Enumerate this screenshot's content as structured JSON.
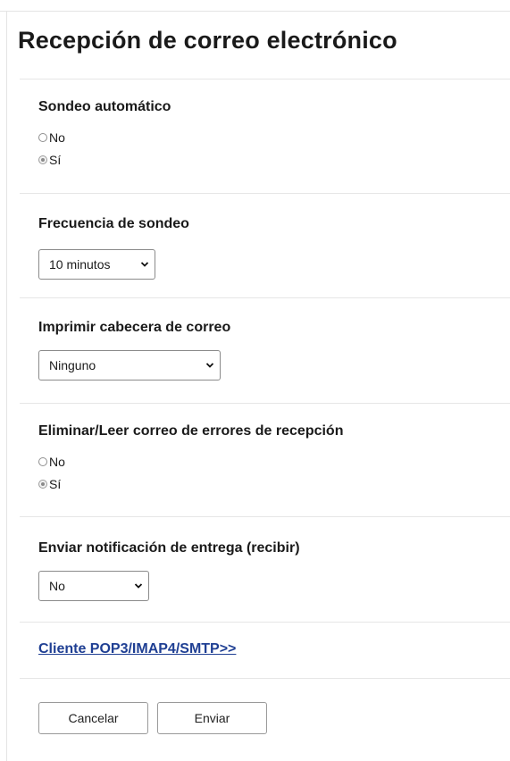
{
  "title": "Recepción de correo electrónico",
  "auto_poll": {
    "label": "Sondeo automático",
    "options": [
      "No",
      "Sí"
    ],
    "selected": "Sí"
  },
  "poll_frequency": {
    "label": "Frecuencia de sondeo",
    "value": "10 minutos"
  },
  "print_header": {
    "label": "Imprimir cabecera de correo",
    "value": "Ninguno"
  },
  "delete_error_mail": {
    "label": "Eliminar/Leer correo de errores de recepción",
    "options": [
      "No",
      "Sí"
    ],
    "selected": "Sí"
  },
  "delivery_notification": {
    "label": "Enviar notificación de entrega (recibir)",
    "value": "No"
  },
  "client_link": "Cliente POP3/IMAP4/SMTP>>",
  "buttons": {
    "cancel": "Cancelar",
    "submit": "Enviar"
  }
}
